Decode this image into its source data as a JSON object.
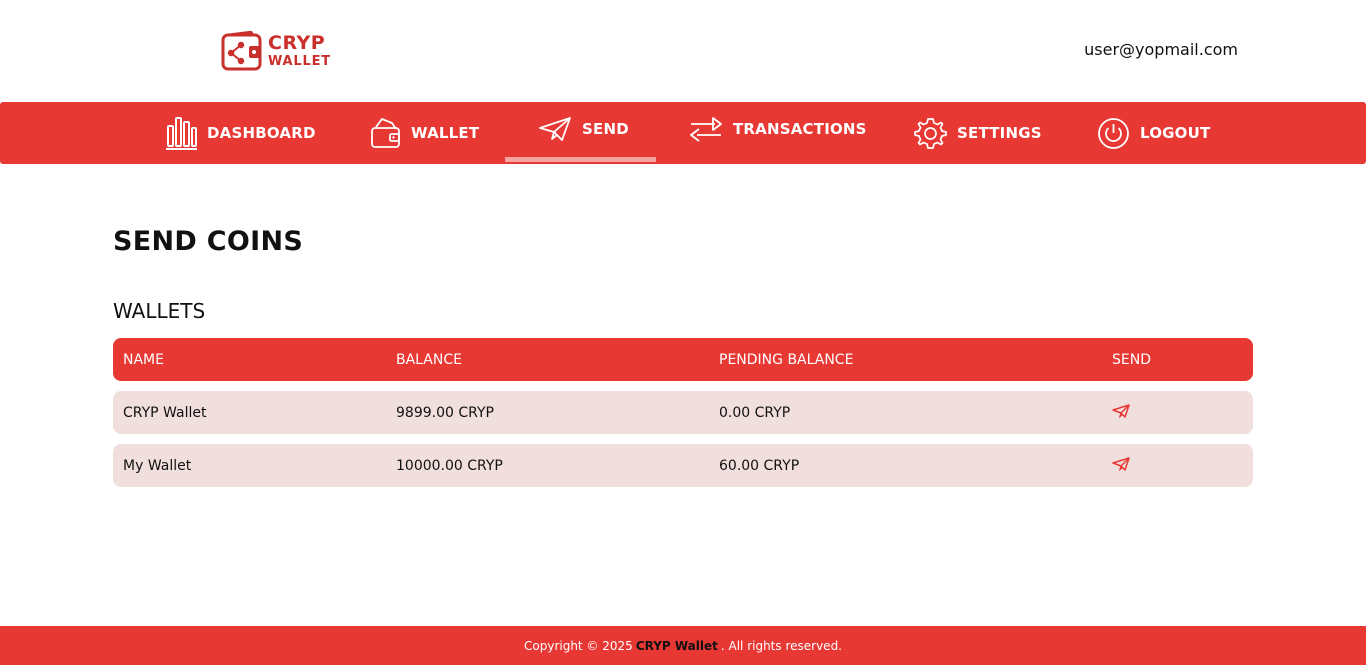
{
  "brand": {
    "line1": "CRYP",
    "line2": "WALLET",
    "color": "#c9302c"
  },
  "header": {
    "user_email": "user@yopmail.com"
  },
  "nav": {
    "items": [
      {
        "label": "DASHBOARD",
        "icon": "bar-chart-icon",
        "active": false
      },
      {
        "label": "WALLET",
        "icon": "wallet-icon",
        "active": false
      },
      {
        "label": "SEND",
        "icon": "paper-plane-icon",
        "active": true
      },
      {
        "label": "TRANSACTIONS",
        "icon": "transfer-arrows-icon",
        "active": false
      },
      {
        "label": "SETTINGS",
        "icon": "gear-icon",
        "active": false
      },
      {
        "label": "LOGOUT",
        "icon": "power-icon",
        "active": false
      }
    ],
    "color": "#e83834"
  },
  "main": {
    "title": "SEND COINS",
    "section_title": "WALLETS",
    "table": {
      "columns": [
        "NAME",
        "BALANCE",
        "PENDING BALANCE",
        "SEND"
      ],
      "rows": [
        {
          "name": "CRYP Wallet",
          "balance": "9899.00 CRYP",
          "pending": "0.00 CRYP",
          "send_icon": "paper-plane-icon"
        },
        {
          "name": "My Wallet",
          "balance": "10000.00 CRYP",
          "pending": "60.00 CRYP",
          "send_icon": "paper-plane-icon"
        }
      ]
    }
  },
  "footer": {
    "prefix": "Copyright © 2025",
    "brand": "CRYP Wallet",
    "suffix": ". All rights reserved."
  }
}
